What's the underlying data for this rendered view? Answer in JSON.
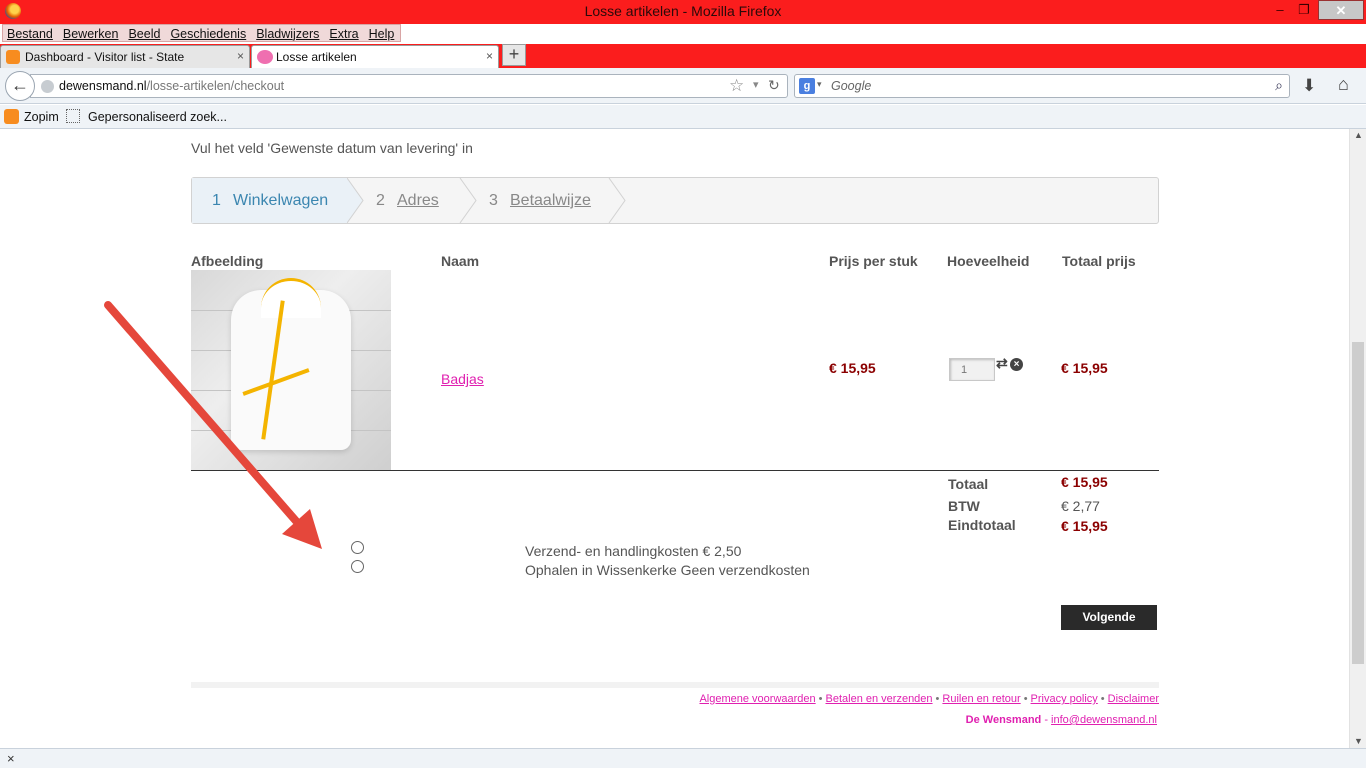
{
  "window": {
    "title": "Losse artikelen - Mozilla Firefox",
    "minimize": "–",
    "maximize": "❐",
    "close": "✕"
  },
  "menu": [
    "Bestand",
    "Bewerken",
    "Beeld",
    "Geschiedenis",
    "Bladwijzers",
    "Extra",
    "Help"
  ],
  "tabs": [
    {
      "label": "Dashboard - Visitor list - State",
      "close": "×"
    },
    {
      "label": "Losse artikelen",
      "close": "×"
    }
  ],
  "new_tab": "+",
  "nav": {
    "back": "←",
    "url_domain": "dewensmand.nl",
    "url_path": "/losse-artikelen/checkout",
    "search_engine": "g",
    "search_placeholder": "Google"
  },
  "bookmarks": [
    "Zopim",
    "Gepersonaliseerd zoek..."
  ],
  "page": {
    "notice": "Vul het veld 'Gewenste datum van levering' in",
    "steps": [
      {
        "num": "1",
        "label": "Winkelwagen"
      },
      {
        "num": "2",
        "label": "Adres"
      },
      {
        "num": "3",
        "label": "Betaalwijze"
      }
    ],
    "table": {
      "headers": [
        "Afbeelding",
        "Naam",
        "Prijs per stuk",
        "Hoeveelheid",
        "Totaal prijs"
      ],
      "rows": [
        {
          "name": "Badjas",
          "unit_price": "€ 15,95",
          "quantity": "1",
          "total": "€ 15,95"
        }
      ]
    },
    "totals": [
      {
        "label": "Totaal",
        "value": "€ 15,95",
        "color": "#8b0000"
      },
      {
        "label": "BTW",
        "value": "€ 2,77",
        "color": "#555555"
      },
      {
        "label": "Eindtotaal",
        "value": "€ 15,95",
        "color": "#8b0000"
      }
    ],
    "shipping_options": [
      "Verzend- en handlingkosten € 2,50",
      "Ophalen in Wissenkerke Geen verzendkosten"
    ],
    "next_button": "Volgende",
    "footer": {
      "links": [
        "Algemene voorwaarden",
        "Betalen en verzenden",
        "Ruilen en retour",
        "Privacy policy",
        "Disclaimer"
      ],
      "brand": "De Wensmand",
      "email": "info@dewensmand.nl"
    }
  },
  "status_close": "×",
  "colors": {
    "titlebar": "#fb1d1d",
    "accent_pink": "#e020b0",
    "price_red": "#8b0000",
    "step_active": "#3b86b0",
    "annotation_arrow": "#e5473b"
  }
}
